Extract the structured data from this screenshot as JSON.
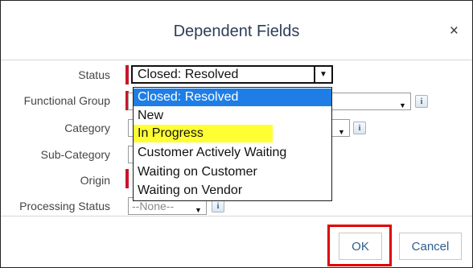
{
  "dialog": {
    "title": "Dependent Fields",
    "close_glyph": "×"
  },
  "fields": {
    "status_label": "Status",
    "functional_group_label": "Functional Group",
    "category_label": "Category",
    "sub_category_label": "Sub-Category",
    "origin_label": "Origin",
    "processing_status_label": "Processing Status"
  },
  "status_select": {
    "value": "Closed: Resolved",
    "arrow_glyph": "▼"
  },
  "processing_status_select": {
    "value": "--None--"
  },
  "dropdown": {
    "options": [
      "Closed: Resolved",
      "New",
      "In Progress",
      "Customer Actively Waiting",
      "Waiting on Customer",
      "Waiting on Vendor"
    ],
    "selected_index": 0,
    "highlighted_index": 2
  },
  "info_glyph": "i",
  "arrow_glyph": "▼",
  "buttons": {
    "ok": "OK",
    "cancel": "Cancel"
  },
  "colors": {
    "title": "#2d3e57",
    "required_marker": "#c9152b",
    "selection": "#1e7ee6",
    "highlight": "#ffff33",
    "ok_highlight_border": "#e00000",
    "button_text": "#2d5d8f"
  },
  "icons": {
    "close": "close-icon",
    "info": "info-icon",
    "dropdown_arrow": "chevron-down-icon"
  }
}
